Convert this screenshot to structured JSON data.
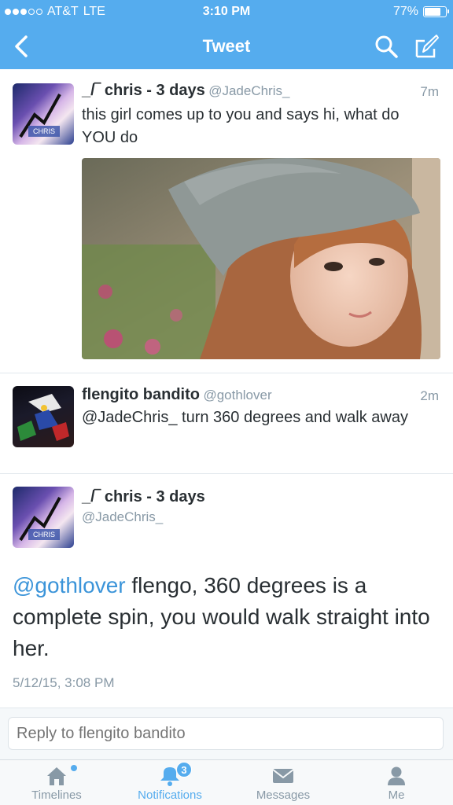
{
  "status": {
    "carrier": "AT&T",
    "network": "LTE",
    "time": "3:10 PM",
    "battery": "77%",
    "battery_level": 0.77
  },
  "nav": {
    "title": "Tweet",
    "icons": [
      "back-arrow-icon",
      "search-icon",
      "compose-icon"
    ]
  },
  "tweets": [
    {
      "name": "_/‾ chris - 3 days",
      "handle": "@JadeChris_",
      "time": "7m",
      "text": "this girl comes up to you and says hi, what do YOU do",
      "avatar_label": "CHRIS"
    },
    {
      "name": "flengito bandito",
      "handle": "@gothlover",
      "time": "2m",
      "mention": "@JadeChris_",
      "text": " turn 360 degrees and walk away"
    },
    {
      "name": "_/‾ chris - 3 days",
      "handle": "@JadeChris_",
      "mention": "@gothlover",
      "text": " flengo, 360 degrees is a complete spin, you would walk straight into her.",
      "timestamp": "5/12/15, 3:08 PM",
      "avatar_label": "CHRIS"
    }
  ],
  "reply": {
    "placeholder": "Reply to flengito bandito"
  },
  "tabs": [
    {
      "label": "Timelines",
      "icon": "home-icon"
    },
    {
      "label": "Notifications",
      "icon": "bell-icon",
      "badge": "3"
    },
    {
      "label": "Messages",
      "icon": "envelope-icon"
    },
    {
      "label": "Me",
      "icon": "person-icon"
    }
  ],
  "colors": {
    "brand": "#55acee",
    "link": "#3b94d9",
    "text": "#292f33",
    "muted": "#8899a6"
  }
}
